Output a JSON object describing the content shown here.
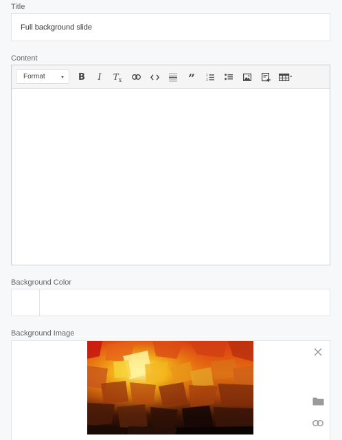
{
  "title": {
    "label": "Title",
    "value": "Full background slide"
  },
  "content": {
    "label": "Content",
    "toolbar": {
      "format_select": "Format",
      "buttons": [
        {
          "name": "bold-icon",
          "glyph": "B"
        },
        {
          "name": "italic-icon",
          "glyph": "I"
        },
        {
          "name": "clear-formatting-icon",
          "glyph": "Tx"
        },
        {
          "name": "link-icon"
        },
        {
          "name": "code-icon"
        },
        {
          "name": "horizontal-rule-icon"
        },
        {
          "name": "blockquote-icon"
        },
        {
          "name": "numbered-list-icon"
        },
        {
          "name": "bulleted-list-icon"
        },
        {
          "name": "image-icon"
        },
        {
          "name": "insert-media-icon"
        },
        {
          "name": "table-icon"
        }
      ]
    },
    "value": ""
  },
  "background_color": {
    "label": "Background Color",
    "value": ""
  },
  "background_image": {
    "label": "Background Image",
    "actions": [
      "close-icon",
      "folder-icon",
      "link-icon"
    ]
  },
  "colors": {
    "page_bg": "#f7f8fa",
    "field_border": "#e3e5e8",
    "toolbar_bg": "#f5f5f5",
    "icon": "#444444",
    "muted_icon": "#9a9a9a"
  }
}
